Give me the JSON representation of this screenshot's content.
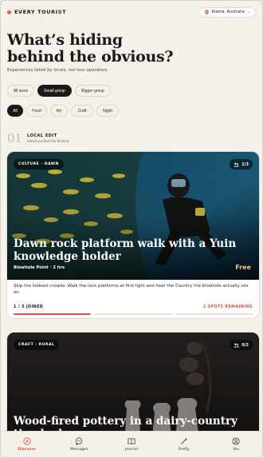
{
  "brand": {
    "name": "EVERY TOURIST",
    "accent": "#e0603f"
  },
  "location": {
    "label": "Kiama, Australia"
  },
  "headline": {
    "line1": "What’s hiding",
    "line2": "behind the obvious?"
  },
  "subhead": "Experiences listed by locals, not tour operators.",
  "size_filters": [
    {
      "label": "All sizes",
      "active": false
    },
    {
      "label": "Small group",
      "active": true
    },
    {
      "label": "Bigger group",
      "active": false
    }
  ],
  "category_filters": [
    {
      "label": "All",
      "active": true
    },
    {
      "label": "Food",
      "active": false
    },
    {
      "label": "Art",
      "active": false
    },
    {
      "label": "Craft",
      "active": false
    },
    {
      "label": "Night",
      "active": false
    }
  ],
  "section": {
    "number": "01",
    "title": "LOCAL EDIT",
    "subtitle": "Hand-picked for Kiama"
  },
  "cards": [
    {
      "tag": "CULTURE · DAWN",
      "count": "1/3",
      "title": "Dawn rock platform walk with a Yuin knowledge holder",
      "meta": "Blowhole Point · 2 hrs",
      "price": "Free",
      "description": "Skip the lookout crowds. Walk the rock platforms at first light and hear the Country the blowhole actually sits on.",
      "joined": "1 / 3 JOINED",
      "spots": "2 SPOTS REMAINING",
      "progress_filled": 1,
      "progress_total": 3
    },
    {
      "tag": "CRAFT · RURAL",
      "count": "0/2",
      "title": "Wood-fired pottery in a dairy-country tin shed"
    }
  ],
  "nav": [
    {
      "label": "Discover",
      "icon": "compass-icon",
      "active": true
    },
    {
      "label": "Messages",
      "icon": "chat-icon",
      "active": false
    },
    {
      "label": "Journal",
      "icon": "book-icon",
      "active": false
    },
    {
      "label": "Firefly",
      "icon": "wand-icon",
      "active": false
    },
    {
      "label": "You",
      "icon": "user-icon",
      "active": false
    }
  ]
}
